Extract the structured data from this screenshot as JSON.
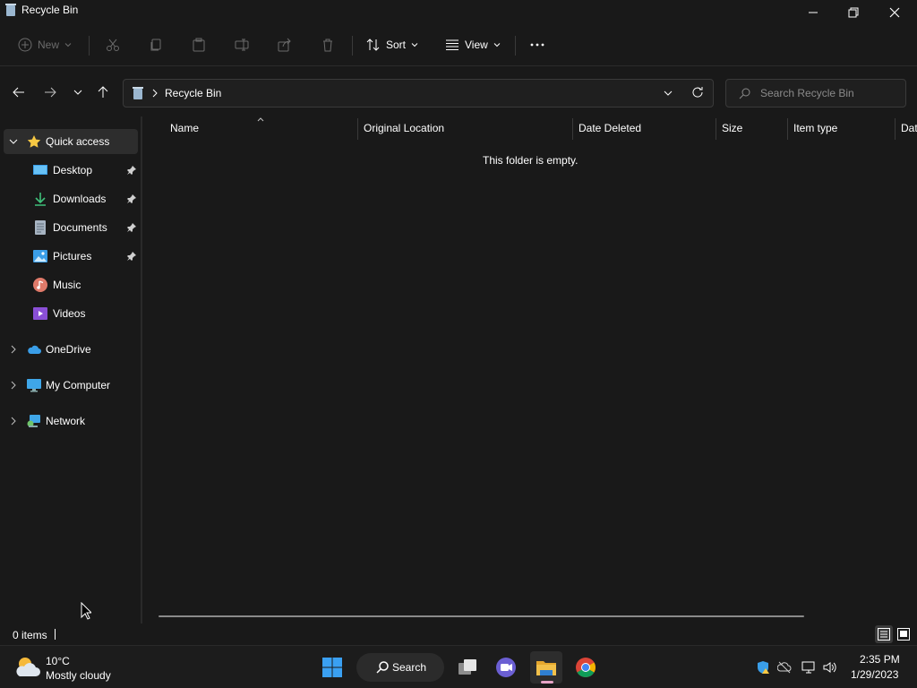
{
  "window": {
    "title": "Recycle Bin",
    "icon": "recycle-bin-icon"
  },
  "toolbar": {
    "new_label": "New",
    "sort_label": "Sort",
    "view_label": "View",
    "more_label": "..."
  },
  "address": {
    "crumb": "Recycle Bin"
  },
  "search": {
    "placeholder": "Search Recycle Bin"
  },
  "sidebar": {
    "quick_access": "Quick access",
    "items": [
      {
        "label": "Desktop",
        "icon": "desktop-icon",
        "pinned": true
      },
      {
        "label": "Downloads",
        "icon": "downloads-icon",
        "pinned": true
      },
      {
        "label": "Documents",
        "icon": "documents-icon",
        "pinned": true
      },
      {
        "label": "Pictures",
        "icon": "pictures-icon",
        "pinned": true
      },
      {
        "label": "Music",
        "icon": "music-icon",
        "pinned": false
      },
      {
        "label": "Videos",
        "icon": "videos-icon",
        "pinned": false
      }
    ],
    "onedrive": "OneDrive",
    "my_computer": "My Computer",
    "network": "Network"
  },
  "columns": [
    "Name",
    "Original Location",
    "Date Deleted",
    "Size",
    "Item type",
    "Dat"
  ],
  "content": {
    "empty_message": "This folder is empty."
  },
  "status": {
    "item_count": "0 items"
  },
  "taskbar": {
    "weather_temp": "10°C",
    "weather_desc": "Mostly cloudy",
    "search_label": "Search",
    "time": "2:35 PM",
    "date": "1/29/2023"
  },
  "colors": {
    "background": "#191919",
    "accent_star": "#f7c843",
    "onedrive_blue": "#3a9ee8",
    "folder_yellow": "#f2c04a"
  }
}
